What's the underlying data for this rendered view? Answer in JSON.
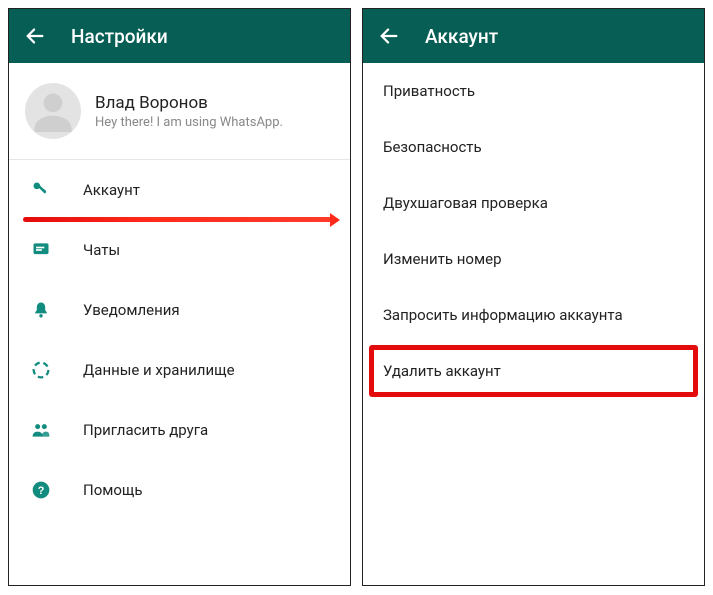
{
  "left": {
    "header_title": "Настройки",
    "profile": {
      "name": "Влад Воронов",
      "status": "Hey there! I am using WhatsApp."
    },
    "menu": [
      {
        "icon": "key-icon",
        "label": "Аккаунт",
        "highlight": true
      },
      {
        "icon": "chat-icon",
        "label": "Чаты"
      },
      {
        "icon": "bell-icon",
        "label": "Уведомления"
      },
      {
        "icon": "data-icon",
        "label": "Данные и хранилище"
      },
      {
        "icon": "invite-icon",
        "label": "Пригласить друга"
      },
      {
        "icon": "help-icon",
        "label": "Помощь"
      }
    ]
  },
  "right": {
    "header_title": "Аккаунт",
    "items": [
      {
        "label": "Приватность"
      },
      {
        "label": "Безопасность"
      },
      {
        "label": "Двухшаговая проверка"
      },
      {
        "label": "Изменить номер"
      },
      {
        "label": "Запросить информацию аккаунта"
      },
      {
        "label": "Удалить аккаунт",
        "boxed": true
      }
    ]
  }
}
